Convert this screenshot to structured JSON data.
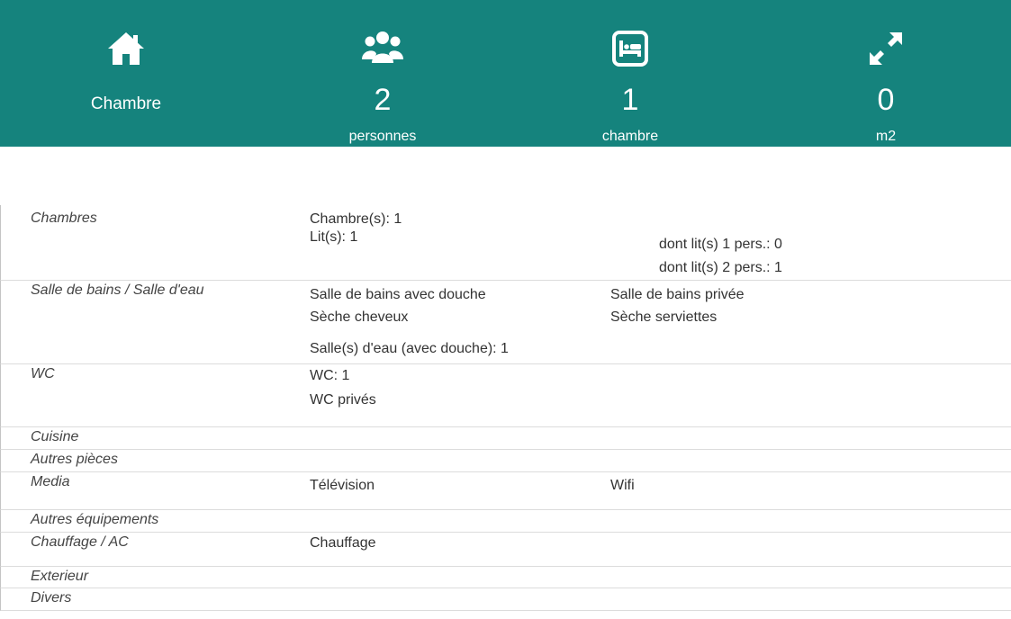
{
  "header": {
    "type_label": "Chambre",
    "persons": {
      "value": "2",
      "unit": "personnes"
    },
    "rooms": {
      "value": "1",
      "unit": "chambre"
    },
    "area": {
      "value": "0",
      "unit": "m2"
    },
    "icons": [
      "home-icon",
      "users-icon",
      "bed-icon",
      "expand-icon"
    ]
  },
  "sections": {
    "chambres": {
      "title": "Chambres",
      "chambres_count": "Chambre(s): 1",
      "lits": "Lit(s):  1",
      "lit1": "dont lit(s) 1 pers.: 0",
      "lit2": "dont lit(s) 2 pers.: 1"
    },
    "salle_bains": {
      "title": "Salle de bains / Salle d'eau",
      "a1": "Salle de bains avec douche",
      "a2": "Salle de bains privée",
      "b1": "Sèche cheveux",
      "b2": "Sèche serviettes",
      "c1": "Salle(s) d'eau (avec douche):  1"
    },
    "wc": {
      "title": "WC",
      "a1": "WC:  1",
      "a2": "WC privés"
    },
    "cuisine": {
      "title": "Cuisine"
    },
    "autres_pieces": {
      "title": "Autres pièces"
    },
    "media": {
      "title": "Media",
      "a1": "Télévision",
      "a2": "Wifi"
    },
    "autres_equipements": {
      "title": "Autres équipements"
    },
    "chauffage": {
      "title": "Chauffage / AC",
      "a1": "Chauffage"
    },
    "exterieur": {
      "title": "Exterieur"
    },
    "divers": {
      "title": "Divers"
    }
  }
}
